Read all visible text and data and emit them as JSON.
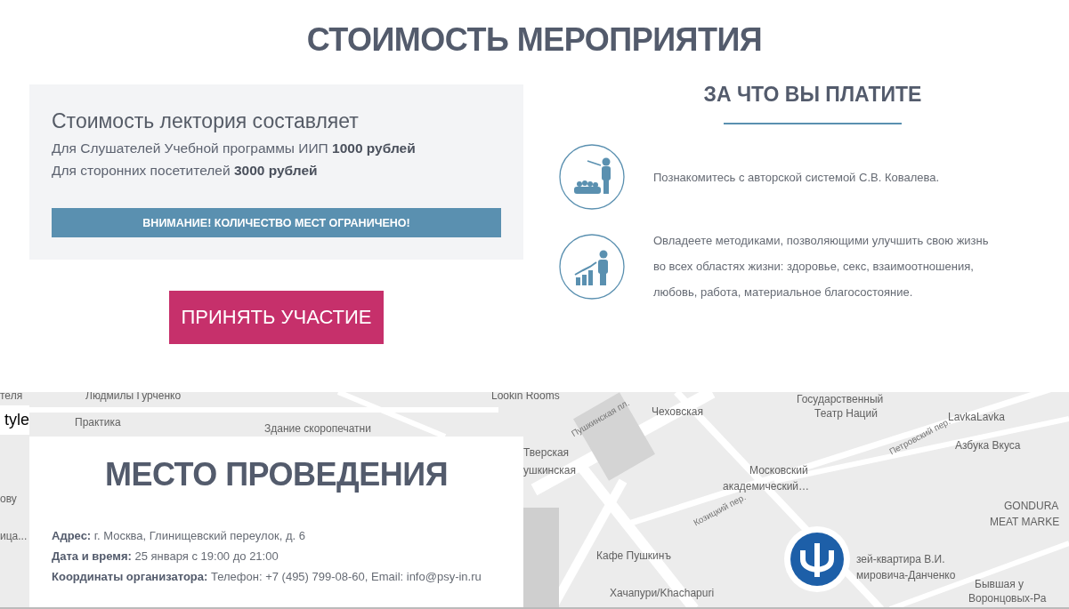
{
  "page_title": "СТОИМОСТЬ МЕРОПРИЯТИЯ",
  "price_card": {
    "heading": "Стоимость лектория составляет",
    "lines": [
      "Для Слушателей Учебной программы ИИП **1000 рублей**",
      "Для сторонних посетителей **3000 рублей**"
    ],
    "notice": "ВНИМАНИЕ! КОЛИЧЕСТВО МЕСТ ОГРАНИЧЕНО!"
  },
  "cta_button": "ПРИНЯТЬ УЧАСТИЕ",
  "benefits": {
    "heading": "ЗА ЧТО ВЫ ПЛАТИТЕ",
    "items": [
      {
        "kind": "lecture",
        "text": "Познакомитесь с авторской системой С.В. Ковалева."
      },
      {
        "kind": "growth",
        "text": "Овладеете методиками, позволяющими улучшить свою жизнь во всех областях жизни: здоровье, секс, взаимоотношения, любовь, работа, материальное благосостояние."
      }
    ]
  },
  "map": {
    "style_control": "tyle",
    "labels": [
      {
        "kind": "place",
        "text": "теля"
      },
      {
        "kind": "place",
        "text": "Людмилы Гурченко"
      },
      {
        "kind": "place",
        "text": "Практика"
      },
      {
        "kind": "place",
        "text": "Здание скоропечатни"
      },
      {
        "kind": "place",
        "text": "Lookin Rooms"
      },
      {
        "kind": "metro",
        "text": "Чеховская"
      },
      {
        "kind": "place",
        "text": "Государственный"
      },
      {
        "kind": "place",
        "text": "Театр Наций"
      },
      {
        "kind": "place",
        "text": "LavkaLavka"
      },
      {
        "kind": "place",
        "text": "Азбука Вкуса"
      },
      {
        "kind": "street",
        "text": "Пушкинская пл."
      },
      {
        "kind": "street",
        "text": "Петровский пер."
      },
      {
        "kind": "metro",
        "text": "Тверская"
      },
      {
        "kind": "metro",
        "text": "ушкинская"
      },
      {
        "kind": "place",
        "text": "Московский"
      },
      {
        "kind": "place",
        "text": "академический…"
      },
      {
        "kind": "place",
        "text": "ову"
      },
      {
        "kind": "place",
        "text": "ица..."
      },
      {
        "kind": "street",
        "text": "Козицкий пер."
      },
      {
        "kind": "place",
        "text": "GONDURA"
      },
      {
        "kind": "place",
        "text": "MEAT MARKE"
      },
      {
        "kind": "place",
        "text": "Кафе Пушкинъ"
      },
      {
        "kind": "place",
        "text": "зей-квартира В.И."
      },
      {
        "kind": "place",
        "text": "мировича-Данченко"
      },
      {
        "kind": "place",
        "text": "Хачапури/Khachapuri"
      },
      {
        "kind": "place",
        "text": "Бывшая у"
      },
      {
        "kind": "place",
        "text": "Воронцовых-Ра"
      }
    ]
  },
  "venue": {
    "heading": "МЕСТО ПРОВЕДЕНИЯ",
    "details": [
      {
        "label": "Адрес:",
        "value": "г. Москва, Глинищевский переулок, д. 6"
      },
      {
        "label": "Дата и время:",
        "value": "25 января с 19:00 до 21:00"
      },
      {
        "label": "Координаты организатора:",
        "value": "Телефон: +7 (495) 799-08-60, Email: info@psy-in.ru"
      }
    ]
  }
}
